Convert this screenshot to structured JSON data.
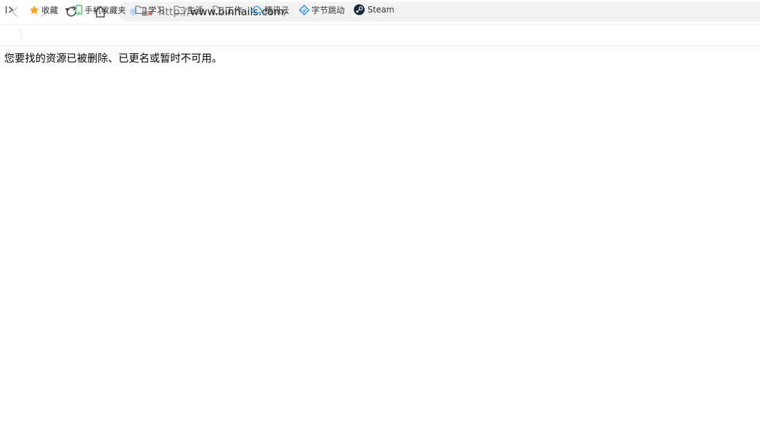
{
  "address_bar": {
    "url_protocol": "http://",
    "url_host": "www.binnails.com",
    "url_path": "/"
  },
  "bookmarks_bar": {
    "items": [
      {
        "label": "收藏",
        "icon": "star-icon",
        "color": "#f5a623"
      },
      {
        "label": "手机收藏夹",
        "icon": "phone-icon",
        "color": "#2ebd59"
      },
      {
        "label": "学习",
        "icon": "folder-icon"
      },
      {
        "label": "生活",
        "icon": "folder-icon"
      },
      {
        "label": "工作",
        "icon": "folder-icon"
      },
      {
        "label": "腾讯云",
        "icon": "tencent-cloud-icon",
        "color": "#1e9be8"
      },
      {
        "label": "字节跳动",
        "icon": "bytedance-icon",
        "color": "#2a8cf0"
      },
      {
        "label": "Steam",
        "icon": "steam-icon",
        "color": "#1b2838"
      }
    ]
  },
  "page": {
    "message": "您要找的资源已被删除、已更名或暂时不可用。"
  }
}
